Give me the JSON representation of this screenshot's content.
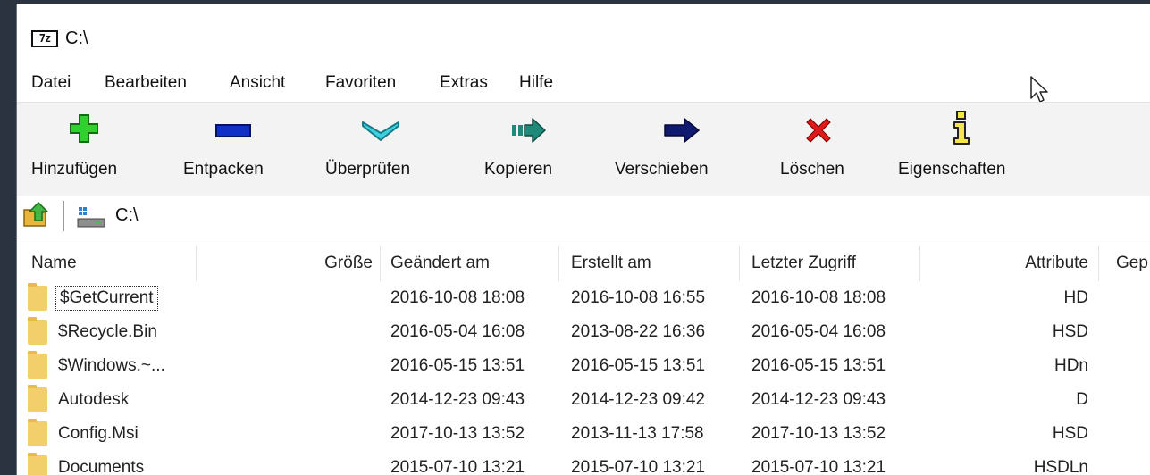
{
  "window": {
    "title": "C:\\",
    "app_icon_label": "7z"
  },
  "menu": {
    "items": [
      {
        "label": "Datei"
      },
      {
        "label": "Bearbeiten"
      },
      {
        "label": "Ansicht"
      },
      {
        "label": "Favoriten"
      },
      {
        "label": "Extras"
      },
      {
        "label": "Hilfe"
      }
    ]
  },
  "toolbar": {
    "buttons": [
      {
        "label": "Hinzufügen",
        "icon": "add-plus-icon",
        "color": "#2fd12f"
      },
      {
        "label": "Entpacken",
        "icon": "extract-minus-icon",
        "color": "#1030c8"
      },
      {
        "label": "Überprüfen",
        "icon": "test-check-icon",
        "color": "#3fd0e0"
      },
      {
        "label": "Kopieren",
        "icon": "copy-arrow-icon",
        "color": "#1f8a7a"
      },
      {
        "label": "Verschieben",
        "icon": "move-arrow-icon",
        "color": "#101a70"
      },
      {
        "label": "Löschen",
        "icon": "delete-x-icon",
        "color": "#e01a1a"
      },
      {
        "label": "Eigenschaften",
        "icon": "info-i-icon",
        "color": "#f3e64a"
      }
    ]
  },
  "address": {
    "path": "C:\\"
  },
  "columns": {
    "name": "Name",
    "size": "Größe",
    "modified": "Geändert am",
    "created": "Erstellt am",
    "accessed": "Letzter Zugriff",
    "attributes": "Attribute",
    "packed": "Gep"
  },
  "rows": [
    {
      "name": "$GetCurrent",
      "modified": "2016-10-08 18:08",
      "created": "2016-10-08 16:55",
      "accessed": "2016-10-08 18:08",
      "attributes": "HD"
    },
    {
      "name": "$Recycle.Bin",
      "modified": "2016-05-04 16:08",
      "created": "2013-08-22 16:36",
      "accessed": "2016-05-04 16:08",
      "attributes": "HSD"
    },
    {
      "name": "$Windows.~...",
      "modified": "2016-05-15 13:51",
      "created": "2016-05-15 13:51",
      "accessed": "2016-05-15 13:51",
      "attributes": "HDn"
    },
    {
      "name": "Autodesk",
      "modified": "2014-12-23 09:43",
      "created": "2014-12-23 09:42",
      "accessed": "2014-12-23 09:43",
      "attributes": "D"
    },
    {
      "name": "Config.Msi",
      "modified": "2017-10-13 13:52",
      "created": "2013-11-13 17:58",
      "accessed": "2017-10-13 13:52",
      "attributes": "HSD"
    },
    {
      "name": "Documents",
      "modified": "2015-07-10 13:21",
      "created": "2015-07-10 13:21",
      "accessed": "2015-07-10 13:21",
      "attributes": "HSDLn"
    }
  ]
}
